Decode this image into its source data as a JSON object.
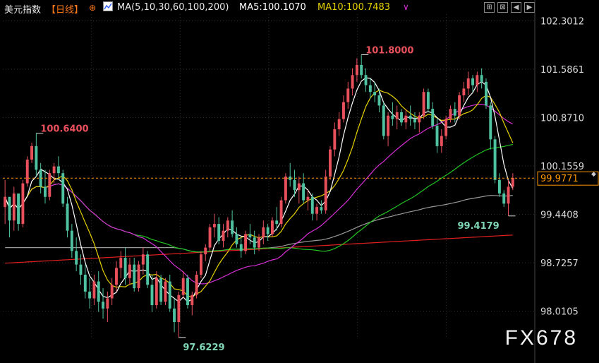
{
  "header": {
    "title": "美元指数",
    "period": "【日线】",
    "ma_settings": "MA(5,10,30,60,100,200)",
    "ma5_label": "MA5:100.1070",
    "ma10_label": "MA10:100.7483",
    "ma5_color": "#ffffff",
    "ma10_color": "#e6d200",
    "tools": [
      "fit-icon",
      "crosshair-icon",
      "back-icon",
      "forward-icon"
    ]
  },
  "watermark": "FX678",
  "footer_text": "",
  "colors": {
    "up": "#e8505c",
    "down": "#4fc3a1",
    "ma5": "#ffffff",
    "ma10": "#e6d200",
    "ma30": "#d62fd6",
    "ma60": "#22c322",
    "ma100": "#9a9a9a",
    "ma200": "#e02020",
    "price_line": "#ff9900"
  },
  "chart_data": {
    "type": "candlestick",
    "ylim": [
      97.6,
      102.4
    ],
    "yticks": [
      "102.3012",
      "101.5861",
      "100.8710",
      "100.1559",
      "99.4408",
      "98.7257",
      "98.0105"
    ],
    "current_price_label": "99.9771",
    "current_price": 99.9771,
    "annotations": [
      {
        "text": "101.8000",
        "value": 101.8,
        "bar": 80,
        "kind": "high"
      },
      {
        "text": "100.6400",
        "value": 100.64,
        "bar": 7,
        "kind": "high"
      },
      {
        "text": "97.6229",
        "value": 97.6229,
        "bar": 39,
        "kind": "low"
      },
      {
        "text": "99.4179",
        "value": 99.4179,
        "bar": 113,
        "kind": "low"
      }
    ],
    "candles": [
      [
        99.55,
        99.95,
        99.3,
        99.7
      ],
      [
        99.7,
        99.6,
        99.1,
        99.35
      ],
      [
        99.35,
        99.85,
        99.2,
        99.75
      ],
      [
        99.75,
        99.4,
        99.2,
        99.3
      ],
      [
        99.3,
        99.95,
        99.25,
        99.9
      ],
      [
        99.9,
        100.3,
        99.85,
        100.25
      ],
      [
        100.25,
        100.5,
        100.2,
        100.45
      ],
      [
        100.45,
        100.64,
        100.0,
        100.1
      ],
      [
        100.1,
        100.2,
        99.75,
        99.85
      ],
      [
        99.85,
        100.1,
        99.6,
        99.7
      ],
      [
        99.7,
        100.1,
        99.65,
        100.05
      ],
      [
        100.05,
        100.2,
        99.9,
        100.15
      ],
      [
        100.15,
        100.3,
        99.95,
        100.05
      ],
      [
        100.05,
        100.1,
        99.55,
        99.6
      ],
      [
        99.6,
        99.7,
        99.1,
        99.2
      ],
      [
        99.2,
        99.3,
        98.8,
        98.9
      ],
      [
        98.9,
        99.1,
        98.6,
        98.7
      ],
      [
        98.7,
        98.85,
        98.4,
        98.55
      ],
      [
        98.55,
        98.7,
        98.2,
        98.3
      ],
      [
        98.3,
        98.5,
        98.05,
        98.2
      ],
      [
        98.2,
        98.55,
        98.1,
        98.45
      ],
      [
        98.45,
        98.6,
        98.0,
        98.15
      ],
      [
        98.15,
        98.35,
        97.9,
        98.05
      ],
      [
        98.05,
        98.3,
        97.85,
        98.2
      ],
      [
        98.2,
        98.5,
        98.1,
        98.4
      ],
      [
        98.4,
        98.75,
        98.3,
        98.65
      ],
      [
        98.65,
        98.9,
        98.5,
        98.8
      ],
      [
        98.8,
        98.95,
        98.4,
        98.5
      ],
      [
        98.5,
        98.8,
        98.4,
        98.7
      ],
      [
        98.7,
        98.8,
        98.3,
        98.35
      ],
      [
        98.35,
        98.75,
        98.3,
        98.7
      ],
      [
        98.7,
        98.95,
        98.55,
        98.85
      ],
      [
        98.85,
        98.9,
        98.35,
        98.4
      ],
      [
        98.4,
        98.55,
        98.0,
        98.1
      ],
      [
        98.1,
        98.6,
        98.05,
        98.5
      ],
      [
        98.5,
        98.55,
        98.1,
        98.15
      ],
      [
        98.15,
        98.5,
        98.1,
        98.45
      ],
      [
        98.45,
        98.55,
        98.0,
        98.05
      ],
      [
        98.05,
        98.2,
        97.7,
        97.85
      ],
      [
        97.85,
        98.3,
        97.62,
        98.25
      ],
      [
        98.25,
        98.6,
        98.2,
        98.5
      ],
      [
        98.5,
        98.55,
        98.05,
        98.1
      ],
      [
        98.1,
        98.3,
        97.95,
        98.25
      ],
      [
        98.25,
        98.6,
        98.2,
        98.55
      ],
      [
        98.55,
        98.9,
        98.5,
        98.85
      ],
      [
        98.85,
        99.0,
        98.75,
        98.95
      ],
      [
        98.95,
        99.3,
        98.9,
        99.25
      ],
      [
        99.25,
        99.45,
        99.1,
        99.3
      ],
      [
        99.3,
        99.4,
        99.0,
        99.05
      ],
      [
        99.05,
        99.3,
        98.95,
        99.2
      ],
      [
        99.2,
        99.4,
        99.1,
        99.35
      ],
      [
        99.35,
        99.5,
        99.1,
        99.15
      ],
      [
        99.15,
        99.25,
        98.95,
        99.0
      ],
      [
        99.0,
        99.1,
        98.8,
        98.9
      ],
      [
        98.9,
        99.2,
        98.85,
        99.15
      ],
      [
        99.15,
        99.3,
        99.0,
        99.1
      ],
      [
        99.1,
        99.2,
        98.85,
        98.95
      ],
      [
        98.95,
        99.15,
        98.9,
        99.1
      ],
      [
        99.1,
        99.35,
        99.0,
        99.25
      ],
      [
        99.25,
        99.3,
        99.05,
        99.15
      ],
      [
        99.15,
        99.4,
        99.1,
        99.35
      ],
      [
        99.35,
        99.55,
        99.2,
        99.3
      ],
      [
        99.3,
        99.7,
        99.25,
        99.65
      ],
      [
        99.65,
        100.05,
        99.6,
        100.0
      ],
      [
        100.0,
        100.2,
        99.85,
        99.95
      ],
      [
        99.95,
        100.1,
        99.7,
        99.8
      ],
      [
        99.8,
        100.0,
        99.6,
        99.9
      ],
      [
        99.9,
        100.05,
        99.6,
        99.65
      ],
      [
        99.65,
        99.8,
        99.5,
        99.7
      ],
      [
        99.7,
        99.75,
        99.35,
        99.45
      ],
      [
        99.45,
        99.6,
        99.35,
        99.55
      ],
      [
        99.55,
        99.65,
        99.45,
        99.5
      ],
      [
        99.5,
        100.1,
        99.45,
        100.0
      ],
      [
        100.0,
        100.45,
        99.95,
        100.4
      ],
      [
        100.4,
        100.8,
        100.3,
        100.7
      ],
      [
        100.7,
        100.95,
        100.6,
        100.85
      ],
      [
        100.85,
        101.2,
        100.8,
        101.1
      ],
      [
        101.1,
        101.4,
        101.0,
        101.3
      ],
      [
        101.3,
        101.6,
        101.2,
        101.5
      ],
      [
        101.5,
        101.75,
        101.4,
        101.65
      ],
      [
        101.65,
        101.8,
        101.45,
        101.5
      ],
      [
        101.5,
        101.6,
        101.25,
        101.35
      ],
      [
        101.35,
        101.45,
        101.15,
        101.25
      ],
      [
        101.25,
        101.4,
        101.1,
        101.2
      ],
      [
        101.2,
        101.3,
        100.95,
        101.05
      ],
      [
        101.05,
        101.1,
        100.55,
        100.6
      ],
      [
        100.6,
        100.95,
        100.45,
        100.9
      ],
      [
        100.9,
        101.1,
        100.75,
        100.85
      ],
      [
        100.85,
        101.05,
        100.7,
        100.95
      ],
      [
        100.95,
        101.0,
        100.75,
        100.8
      ],
      [
        100.8,
        101.0,
        100.7,
        100.9
      ],
      [
        100.9,
        101.05,
        100.75,
        100.85
      ],
      [
        100.85,
        100.95,
        100.7,
        100.8
      ],
      [
        100.8,
        100.95,
        100.65,
        100.9
      ],
      [
        100.9,
        101.3,
        100.85,
        101.25
      ],
      [
        101.25,
        101.3,
        100.95,
        101.0
      ],
      [
        101.0,
        101.1,
        100.7,
        100.75
      ],
      [
        100.75,
        100.85,
        100.35,
        100.45
      ],
      [
        100.45,
        100.7,
        100.35,
        100.6
      ],
      [
        100.6,
        100.9,
        100.55,
        100.85
      ],
      [
        100.85,
        101.05,
        100.8,
        101.0
      ],
      [
        101.0,
        101.1,
        100.8,
        100.9
      ],
      [
        100.9,
        101.25,
        100.85,
        101.2
      ],
      [
        101.2,
        101.4,
        101.1,
        101.3
      ],
      [
        101.3,
        101.55,
        101.2,
        101.45
      ],
      [
        101.45,
        101.5,
        101.25,
        101.35
      ],
      [
        101.35,
        101.55,
        101.25,
        101.5
      ],
      [
        101.5,
        101.6,
        101.3,
        101.4
      ],
      [
        101.4,
        101.45,
        101.0,
        101.05
      ],
      [
        101.05,
        101.1,
        100.4,
        100.55
      ],
      [
        100.55,
        100.6,
        99.9,
        99.95
      ],
      [
        99.95,
        100.05,
        99.7,
        99.75
      ],
      [
        99.75,
        99.8,
        99.55,
        99.6
      ],
      [
        99.6,
        99.95,
        99.42,
        99.85
      ],
      [
        99.85,
        100.05,
        99.8,
        99.98
      ]
    ]
  }
}
